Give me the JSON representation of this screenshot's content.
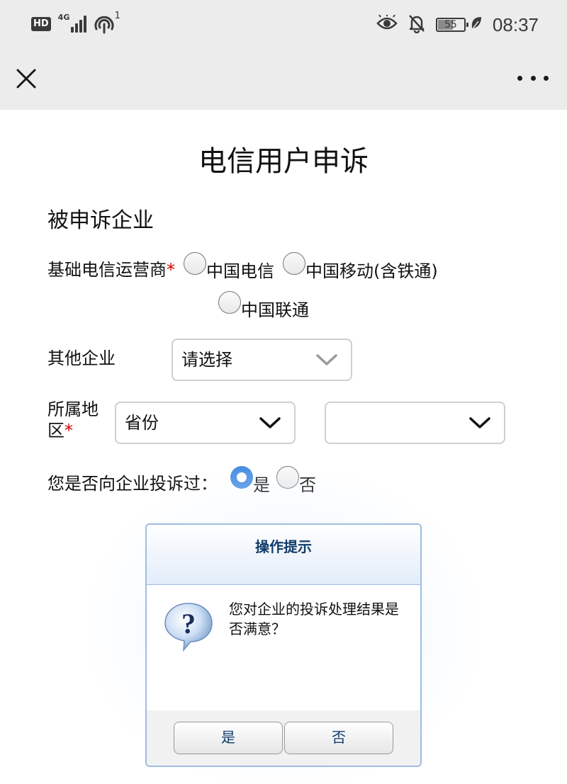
{
  "status_bar": {
    "hd": "HD",
    "network": "4G",
    "wifi_sup": "1",
    "battery": "55",
    "battery_level": 0.55,
    "time": "08:37"
  },
  "page": {
    "title": "电信用户申诉",
    "section_title": "被申诉企业"
  },
  "form": {
    "operator": {
      "label": "基础电信运营商",
      "required_mark": "*",
      "options": [
        "中国电信",
        "中国移动(含铁通)",
        "中国联通"
      ]
    },
    "other": {
      "label": "其他企业",
      "select_value": "请选择"
    },
    "region": {
      "label_line1": "所属地",
      "label_line2": "区",
      "required_mark": "*",
      "province_value": "省份",
      "city_value": ""
    },
    "complained": {
      "label": "您是否向企业投诉过：",
      "options": [
        "是",
        "否"
      ],
      "selected": "是"
    }
  },
  "dialog": {
    "title": "操作提示",
    "message": "您对企业的投诉处理结果是否满意？",
    "yes_label": "是",
    "no_label": "否"
  },
  "colors": {
    "accent": "#4a90e2",
    "required": "#d00000",
    "dialog_border": "#9dbde0",
    "dialog_title": "#123c6a"
  },
  "icons": {
    "close": "close-icon",
    "more": "more-icon",
    "question": "question-icon",
    "chevron": "chevron-down-icon"
  }
}
